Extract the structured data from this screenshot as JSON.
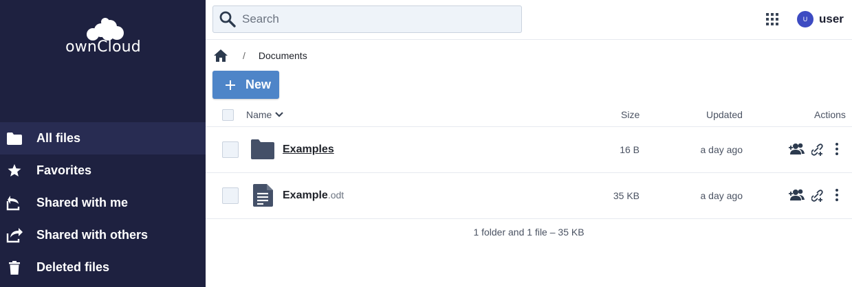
{
  "brand": {
    "logo_text": "ownCloud"
  },
  "sidebar": {
    "items": [
      {
        "label": "All files",
        "icon": "folder-icon"
      },
      {
        "label": "Favorites",
        "icon": "star-icon"
      },
      {
        "label": "Shared with me",
        "icon": "shared-with-me-icon"
      },
      {
        "label": "Shared with others",
        "icon": "shared-with-others-icon"
      },
      {
        "label": "Deleted files",
        "icon": "trash-icon"
      }
    ],
    "active_index": 0
  },
  "header": {
    "search_placeholder": "Search",
    "avatar_initial": "U",
    "username": "user"
  },
  "breadcrumb": {
    "separator": "/",
    "current": "Documents"
  },
  "toolbar": {
    "new_label": "New"
  },
  "table": {
    "columns": {
      "name": "Name",
      "size": "Size",
      "updated": "Updated",
      "actions": "Actions"
    },
    "rows": [
      {
        "name": "Examples",
        "ext": "",
        "type": "folder",
        "size": "16 B",
        "updated": "a day ago"
      },
      {
        "name": "Example",
        "ext": ".odt",
        "type": "document",
        "size": "35 KB",
        "updated": "a day ago"
      }
    ]
  },
  "footer": {
    "summary": "1 folder and 1 file – 35 KB"
  },
  "colors": {
    "sidebar_bg": "#1e2140",
    "sidebar_active": "#282c52",
    "accent": "#4e85c8",
    "icon_dark": "#445068"
  }
}
